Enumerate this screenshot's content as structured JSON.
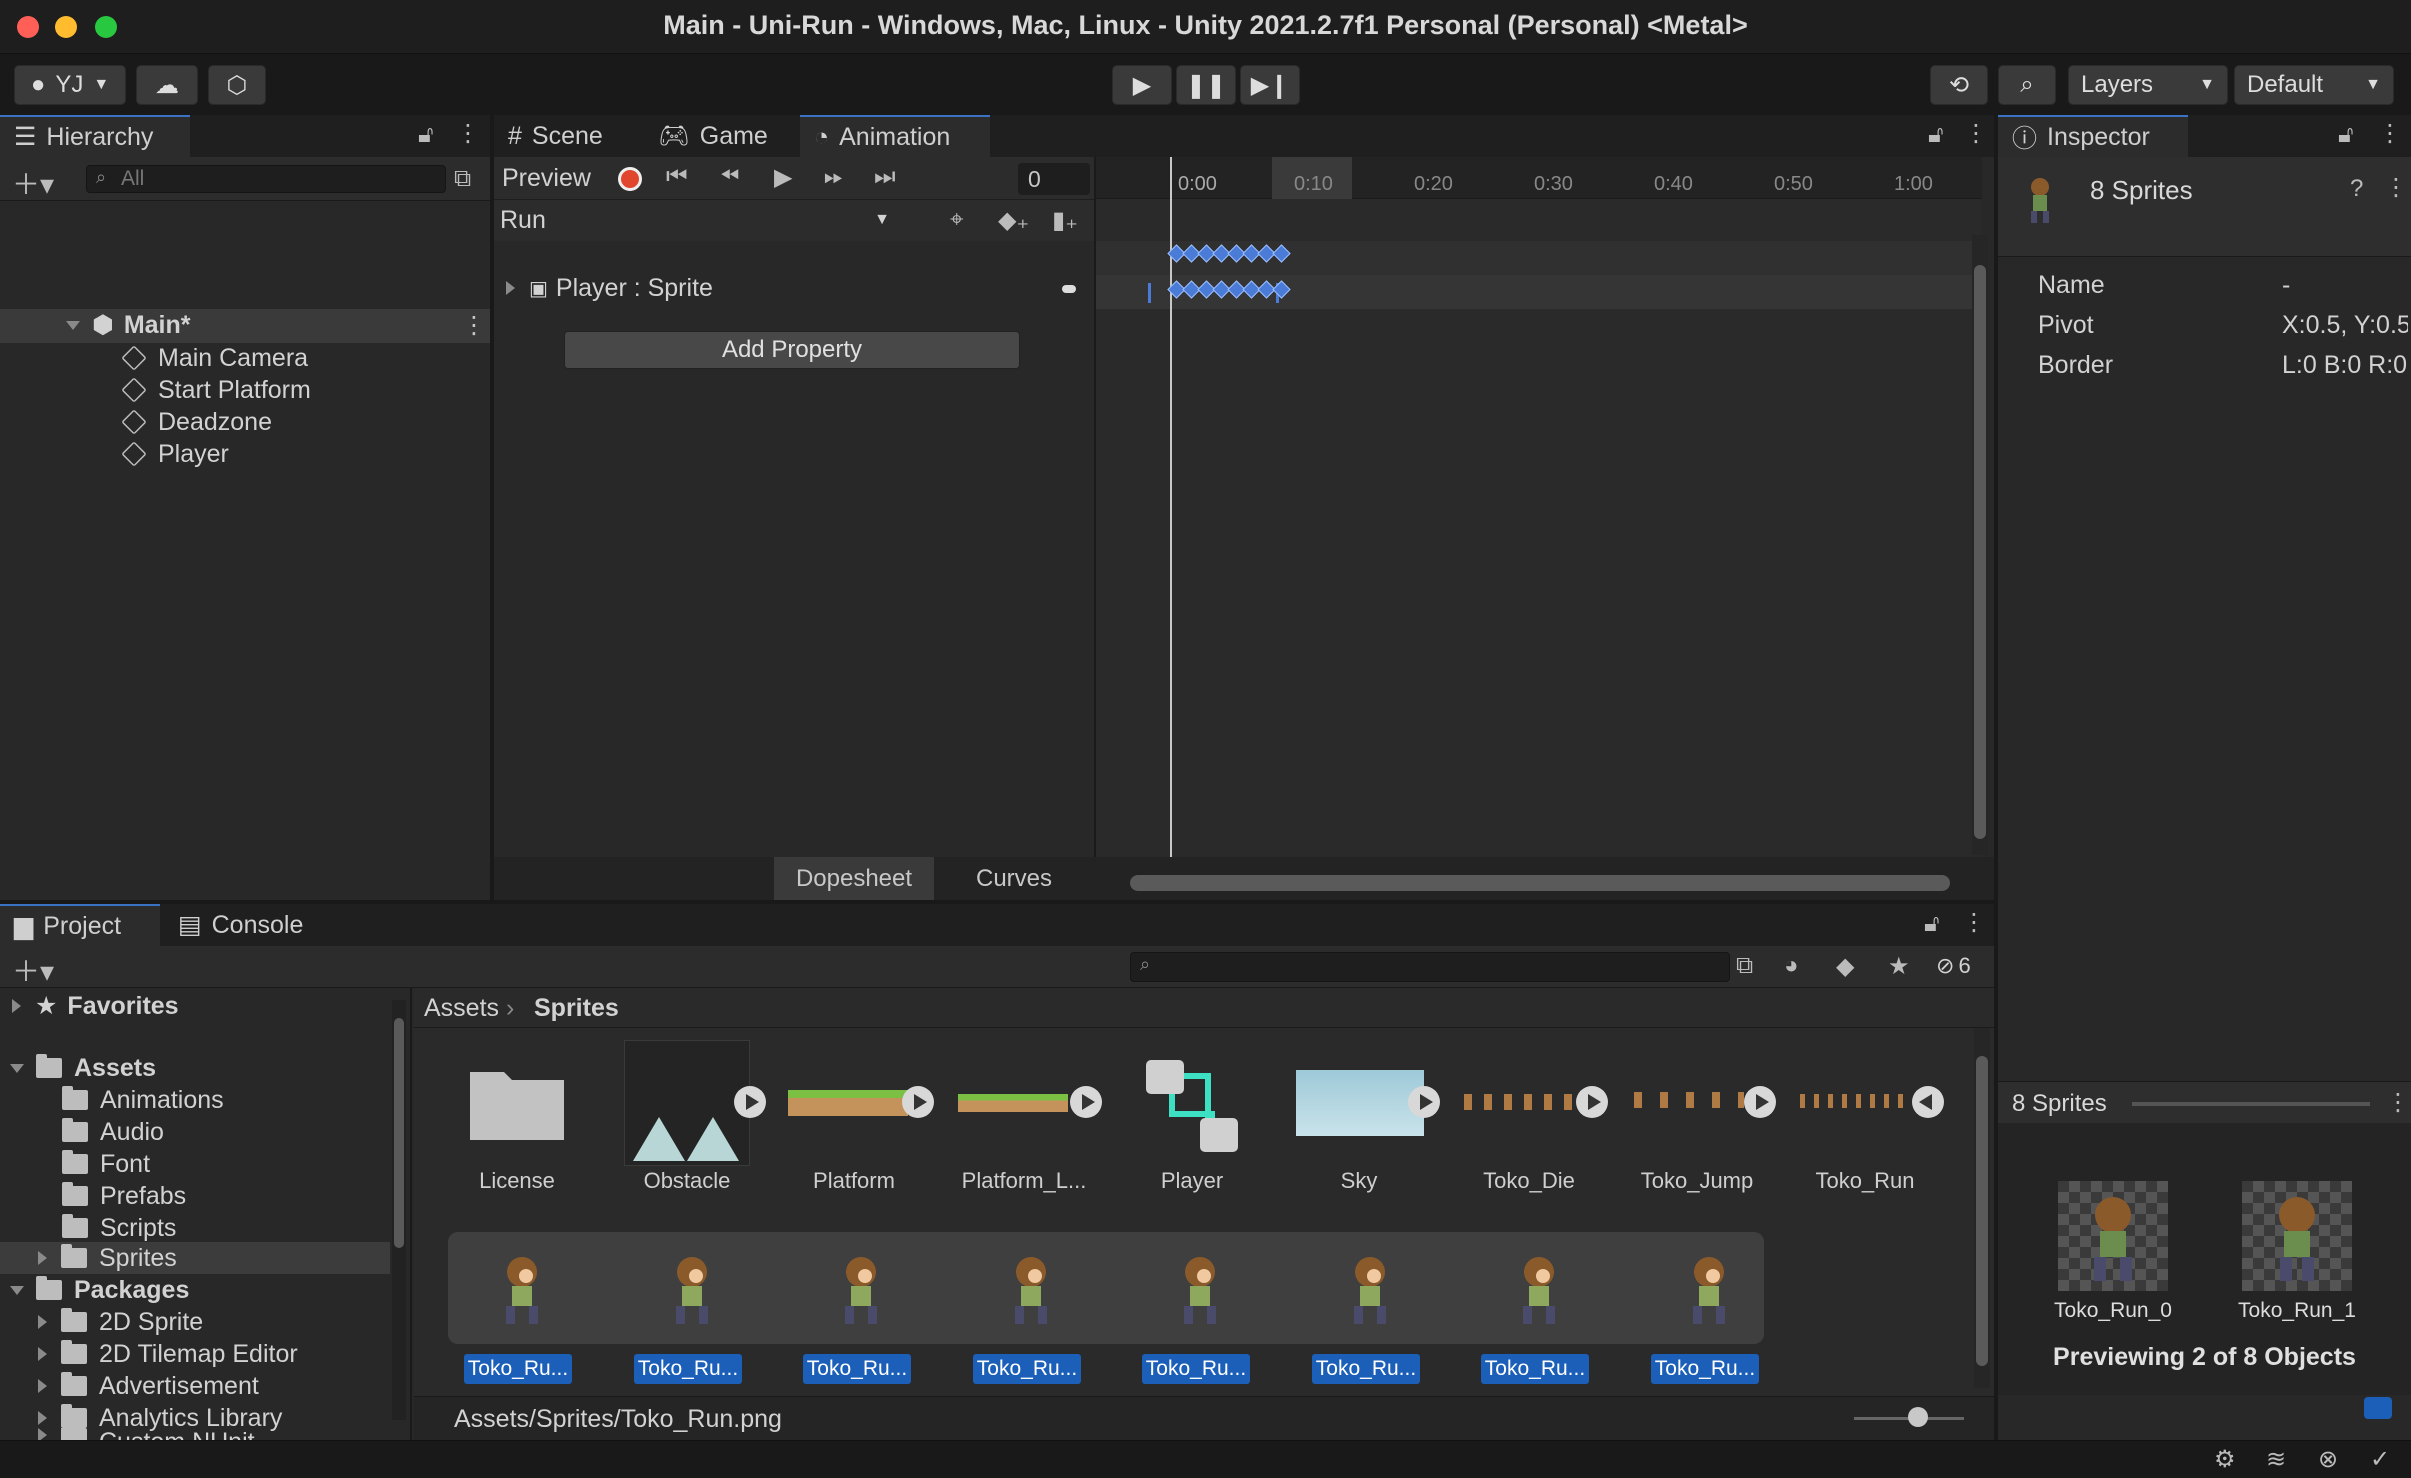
{
  "window": {
    "title": "Main - Uni-Run - Windows, Mac, Linux - Unity 2021.2.7f1 Personal (Personal) <Metal>"
  },
  "toolbar": {
    "account": "YJ",
    "layers": "Layers",
    "layout": "Default"
  },
  "hierarchy": {
    "tab": "Hierarchy",
    "search_placeholder": "All",
    "scene": "Main*",
    "items": [
      "Main Camera",
      "Start Platform",
      "Deadzone",
      "Player"
    ]
  },
  "animation": {
    "tabs": [
      "Scene",
      "Game",
      "Animation"
    ],
    "preview": "Preview",
    "frame": "0",
    "clip": "Run",
    "property": "Player : Sprite",
    "add_property": "Add Property",
    "ruler": [
      "0:00",
      "0:10",
      "0:20",
      "0:30",
      "0:40",
      "0:50",
      "1:00"
    ],
    "bottom_tabs": [
      "Dopesheet",
      "Curves"
    ]
  },
  "inspector": {
    "tab": "Inspector",
    "title": "8 Sprites",
    "fields": [
      {
        "label": "Name",
        "value": "-"
      },
      {
        "label": "Pivot",
        "value": "X:0.5, Y:0.5"
      },
      {
        "label": "Border",
        "value": "L:0 B:0 R:0"
      }
    ],
    "preview_title": "8 Sprites",
    "previews": [
      "Toko_Run_0",
      "Toko_Run_1"
    ],
    "preview_caption": "Previewing 2 of 8 Objects"
  },
  "project": {
    "tabs": [
      "Project",
      "Console"
    ],
    "hidden_count": "6",
    "favorites": "Favorites",
    "assets": "Assets",
    "asset_folders": [
      "Animations",
      "Audio",
      "Font",
      "Prefabs",
      "Scripts",
      "Sprites"
    ],
    "packages": "Packages",
    "package_folders": [
      "2D Sprite",
      "2D Tilemap Editor",
      "Advertisement",
      "Analytics Library",
      "Custom NUnit"
    ],
    "breadcrumb": [
      "Assets",
      "Sprites"
    ],
    "grid": [
      "License",
      "Obstacle",
      "Platform",
      "Platform_L...",
      "Player",
      "Sky",
      "Toko_Die",
      "Toko_Jump",
      "Toko_Run"
    ],
    "sub_sprites": [
      "Toko_Ru...",
      "Toko_Ru...",
      "Toko_Ru...",
      "Toko_Ru...",
      "Toko_Ru...",
      "Toko_Ru...",
      "Toko_Ru...",
      "Toko_Ru..."
    ],
    "status_path": "Assets/Sprites/Toko_Run.png"
  },
  "colors": {
    "accent": "#3a72c4",
    "record": "#e0452e",
    "keyframe": "#4a7bd6"
  }
}
